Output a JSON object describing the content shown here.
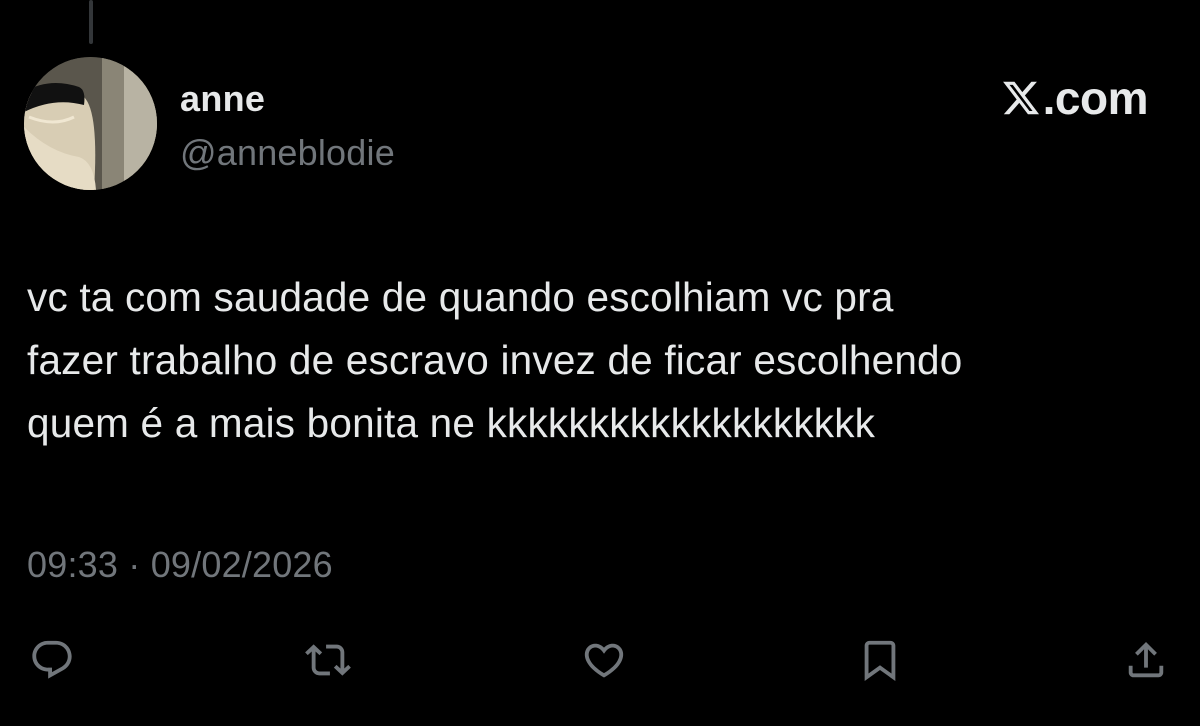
{
  "tweet": {
    "display_name": "anne",
    "handle": "@anneblodie",
    "text": "vc ta com saudade de quando escolhiam vc pra\nfazer trabalho de escravo invez de ficar escolhendo\nquem é a mais bonita ne kkkkkkkkkkkkkkkkkkk",
    "time": "09:33",
    "separator": "·",
    "date": "09/02/2026"
  },
  "brand": {
    "text": ".com",
    "logo_icon": "x-logo-icon"
  },
  "actions": [
    {
      "name": "reply",
      "icon": "reply-icon"
    },
    {
      "name": "repost",
      "icon": "repost-icon"
    },
    {
      "name": "like",
      "icon": "heart-icon"
    },
    {
      "name": "bookmark",
      "icon": "bookmark-icon"
    },
    {
      "name": "share",
      "icon": "share-icon"
    }
  ],
  "colors": {
    "background": "#000000",
    "primary_text": "#e7e9ea",
    "secondary_text": "#71767b"
  }
}
